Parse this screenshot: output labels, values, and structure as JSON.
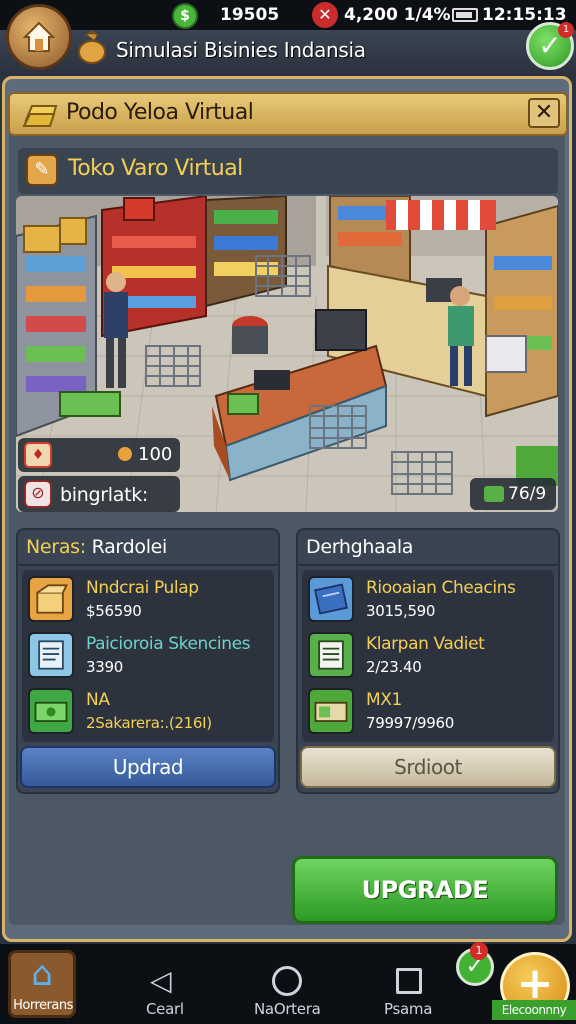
{
  "status_bar": {
    "left_value": "19505",
    "mid_value": "4,200 1/4%",
    "right_value": "12:15:13"
  },
  "header": {
    "title": "Simulasi Bisinies Indansia"
  },
  "panel": {
    "title": "Podo Yeloa Virtual",
    "store_name": "Toko Varo Virtual",
    "scene": {
      "coin_value": "100",
      "label": "bingrlatk:",
      "income_value": "76/9"
    }
  },
  "left_column": {
    "title_prefix": "Neras:",
    "title_rest": " Rardolei",
    "items": [
      {
        "name": "Nndcrai Pulap",
        "value": "$56590",
        "icon": "crate-icon"
      },
      {
        "name": "Paicioroia Skencines",
        "value": "3390",
        "icon": "document-icon"
      },
      {
        "name": "NA",
        "value": "2Sakarera:.(216I)",
        "icon": "cash-icon"
      }
    ],
    "button": "Updrad"
  },
  "right_column": {
    "title": "Derhghaala",
    "items": [
      {
        "name": "Riooaian Cheacins",
        "value": "3015,590",
        "icon": "card-icon"
      },
      {
        "name": "Klarpan Vadiet",
        "value": "2/23.40",
        "icon": "ledger-icon"
      },
      {
        "name": "MX1",
        "value": "79997/9960",
        "icon": "banknote-icon"
      }
    ],
    "button": "Srdioot"
  },
  "upgrade_button": "UPGRADE",
  "nav": {
    "home": "Horrerans",
    "back": "Cearl",
    "center": "NaOrtera",
    "recent": "Psama",
    "plus": "Elecoonnny",
    "check_badge": "1",
    "header_badge": "1"
  },
  "colors": {
    "accent_gold": "#d7b46a",
    "title_yellow": "#f2cf55",
    "green": "#2b9a24",
    "blue_button": "#355a9a"
  }
}
